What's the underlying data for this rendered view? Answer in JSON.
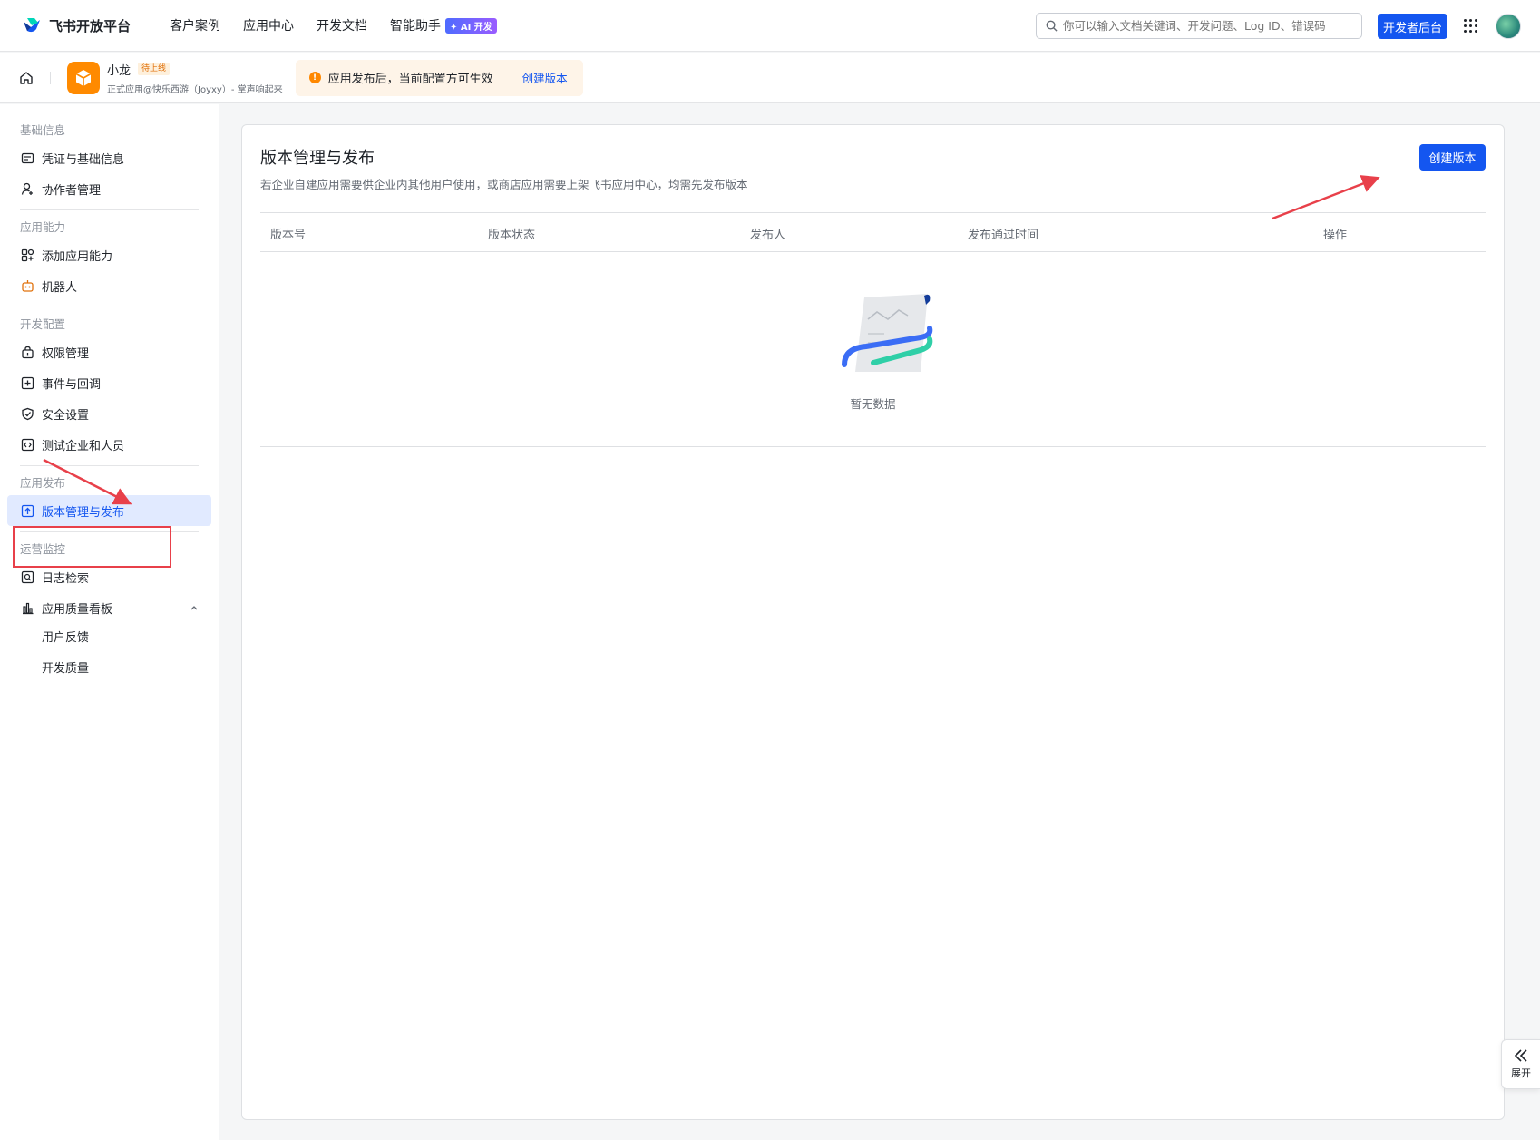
{
  "brand": {
    "name": "飞书开放平台"
  },
  "nav": {
    "items": [
      "客户案例",
      "应用中心",
      "开发文档",
      "智能助手"
    ],
    "ai_badge": "✦ AI 开发"
  },
  "search": {
    "placeholder": "你可以输入文档关键词、开发问题、Log ID、错误码"
  },
  "dev_console_label": "开发者后台",
  "app": {
    "name": "小龙",
    "status": "待上线",
    "subtitle": "正式应用@快乐西游（Joyxy）- 掌声响起来"
  },
  "notice": {
    "text": "应用发布后，当前配置方可生效",
    "link": "创建版本"
  },
  "sidebar": {
    "groups": [
      {
        "title": "基础信息",
        "items": [
          "凭证与基础信息",
          "协作者管理"
        ]
      },
      {
        "title": "应用能力",
        "items": [
          "添加应用能力",
          "机器人"
        ]
      },
      {
        "title": "开发配置",
        "items": [
          "权限管理",
          "事件与回调",
          "安全设置",
          "测试企业和人员"
        ]
      },
      {
        "title": "应用发布",
        "items": [
          "版本管理与发布"
        ]
      },
      {
        "title": "运营监控",
        "items": [
          "日志检索",
          "应用质量看板"
        ],
        "subitems": [
          "用户反馈",
          "开发质量"
        ]
      }
    ]
  },
  "main": {
    "title": "版本管理与发布",
    "description": "若企业自建应用需要供企业内其他用户使用，或商店应用需要上架飞书应用中心，均需先发布版本",
    "create_button": "创建版本",
    "columns": [
      "版本号",
      "版本状态",
      "发布人",
      "发布通过时间",
      "操作"
    ],
    "empty_text": "暂无数据"
  },
  "expand": {
    "label": "展开"
  },
  "colors": {
    "primary": "#1456f0",
    "annotation": "#e8404a",
    "app_icon": "#ff8a00"
  }
}
